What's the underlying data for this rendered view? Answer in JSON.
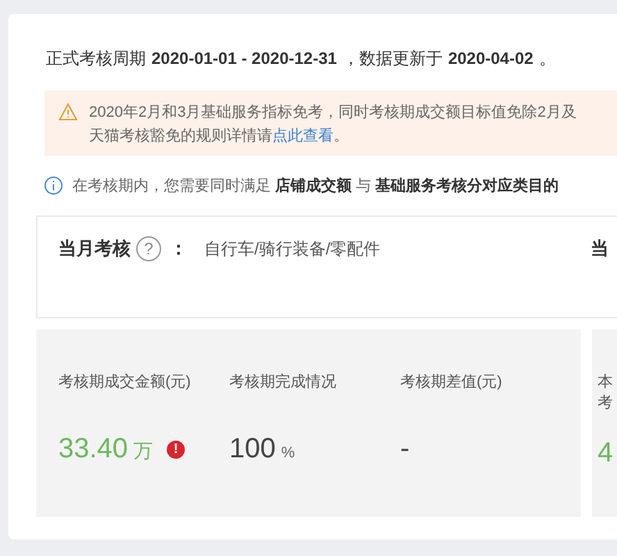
{
  "period": {
    "label": "正式考核周期",
    "range": "2020-01-01 - 2020-12-31",
    "updated_label": "，数据更新于",
    "updated": "2020-04-02",
    "end": "。"
  },
  "notice": {
    "line1": "2020年2月和3月基础服务指标免考，同时考核期成交额目标值免除2月及",
    "line2": "天猫考核豁免的规则详情请",
    "link": "点此查看",
    "end": "。"
  },
  "info": "在考核期内，您需要同时满足 **店铺成交额** 与 **基础服务考核分对应类目的**",
  "monthly": {
    "title": "当月考核",
    "help": "?",
    "colon": "：",
    "category": "自行车/骑行装备/零配件",
    "next_title": "当"
  },
  "stats": [
    {
      "label": "考核期成交金额(元)",
      "value": "33.40",
      "unit": "万",
      "positive": true,
      "alert": true,
      "alert_icon": "!"
    },
    {
      "label": "考核期完成情况",
      "value": "100",
      "unit": "%",
      "positive": false,
      "alert": false
    },
    {
      "label": "考核期差值(元)",
      "value": "-",
      "positive": false,
      "alert": false
    }
  ],
  "side_stat": {
    "label_lines": [
      "本",
      "考"
    ],
    "value": "4",
    "positive": true
  }
}
